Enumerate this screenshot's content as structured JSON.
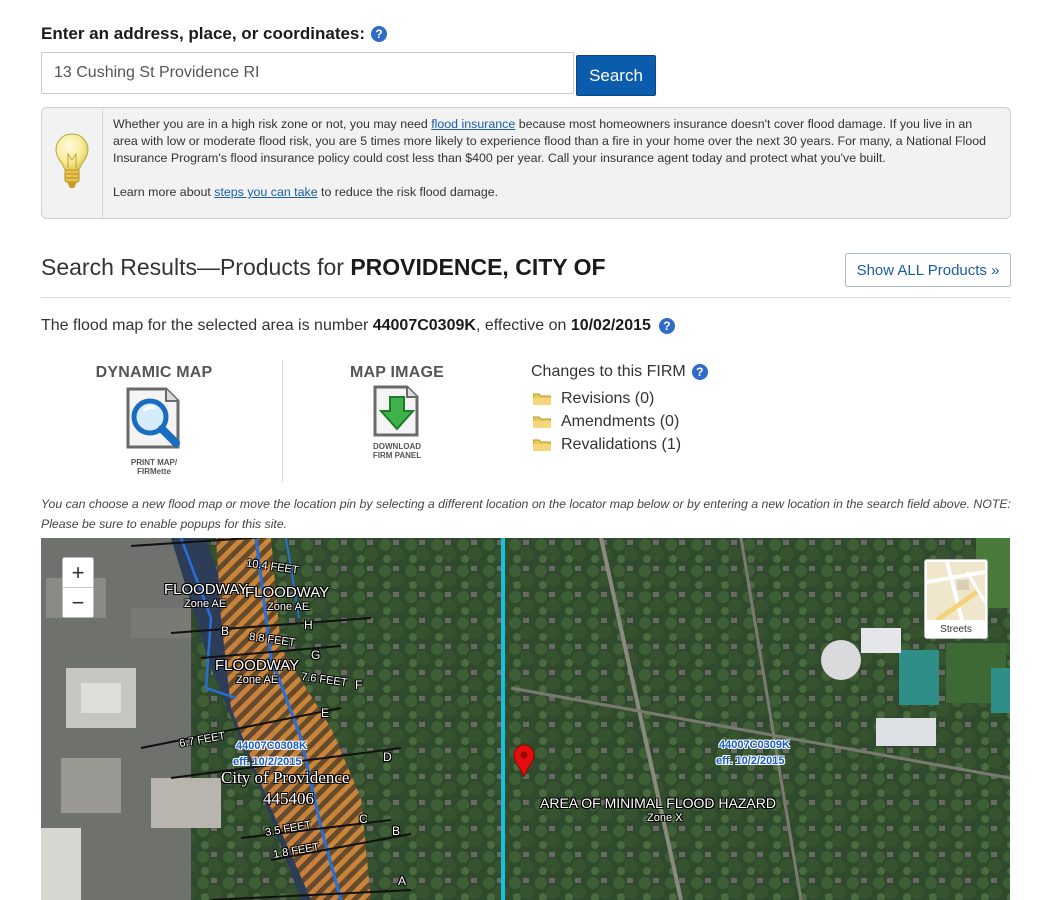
{
  "search": {
    "label": "Enter an address, place, or coordinates:",
    "value": "13 Cushing St Providence RI",
    "button": "Search"
  },
  "info": {
    "p1_before": "Whether you are in a high risk zone or not, you may need ",
    "p1_link": "flood insurance",
    "p1_after": " because most homeowners insurance doesn't cover flood damage. If you live in an area with low or moderate flood risk, you are 5 times more likely to experience flood than a fire in your home over the next 30 years. For many, a National Flood Insurance Program's flood insurance policy could cost less than $400 per year. Call your insurance agent today and protect what you've built.",
    "p2_before": "Learn more about ",
    "p2_link": "steps you can take",
    "p2_after": " to reduce the risk flood damage."
  },
  "results": {
    "title_prefix": "Search Results—Products for ",
    "title_place": "PROVIDENCE, CITY OF",
    "show_all": "Show ALL Products »",
    "flood_prefix": "The flood map for the selected area is number ",
    "map_number": "44007C0309K",
    "flood_mid": ", effective on ",
    "effective_date": "10/02/2015"
  },
  "products": {
    "dynamic": {
      "heading": "DYNAMIC MAP",
      "sub1": "PRINT MAP/",
      "sub2": "FIRMette"
    },
    "image": {
      "heading": "MAP IMAGE",
      "sub1": "DOWNLOAD",
      "sub2": "FIRM PANEL"
    }
  },
  "changes": {
    "title": "Changes to this FIRM",
    "items": [
      "Revisions (0)",
      "Amendments (0)",
      "Revalidations (1)"
    ]
  },
  "note": "You can choose a new flood map or move the location pin by selecting a different location on the locator map below or by entering a new location in the search field above. NOTE: Please be sure to enable popups for this site.",
  "map": {
    "zoom_in": "+",
    "zoom_out": "−",
    "basemap_label": "Streets",
    "labels": {
      "floodway1": "FLOODWAY",
      "zone_ae1": "Zone AE",
      "floodway2": "FLOODWAY",
      "zone_ae2": "Zone AE",
      "floodway3": "FLOODWAY",
      "zone_ae3": "Zone AE",
      "feet1": "10.4 FEET",
      "feet2": "8.8 FEET",
      "feet3": "7.6 FEET",
      "feet4": "6.7 FEET",
      "feet5": "3.5 FEET",
      "feet6": "1.8 FEET",
      "panel_left1": "44007C0308K",
      "panel_left2": "eff. 10/2/2015",
      "city": "City of Providence",
      "city_num": "445406",
      "panel_right1": "44007C0309K",
      "panel_right2": "eff. 10/2/2015",
      "minimal": "AREA OF MINIMAL FLOOD HAZARD",
      "zone_x": "Zone X",
      "letter_a": "A",
      "letter_b": "B",
      "letter_b2": "B",
      "letter_c": "C",
      "letter_d": "D",
      "letter_e": "E",
      "letter_f": "F",
      "letter_g": "G",
      "letter_h": "H"
    }
  }
}
